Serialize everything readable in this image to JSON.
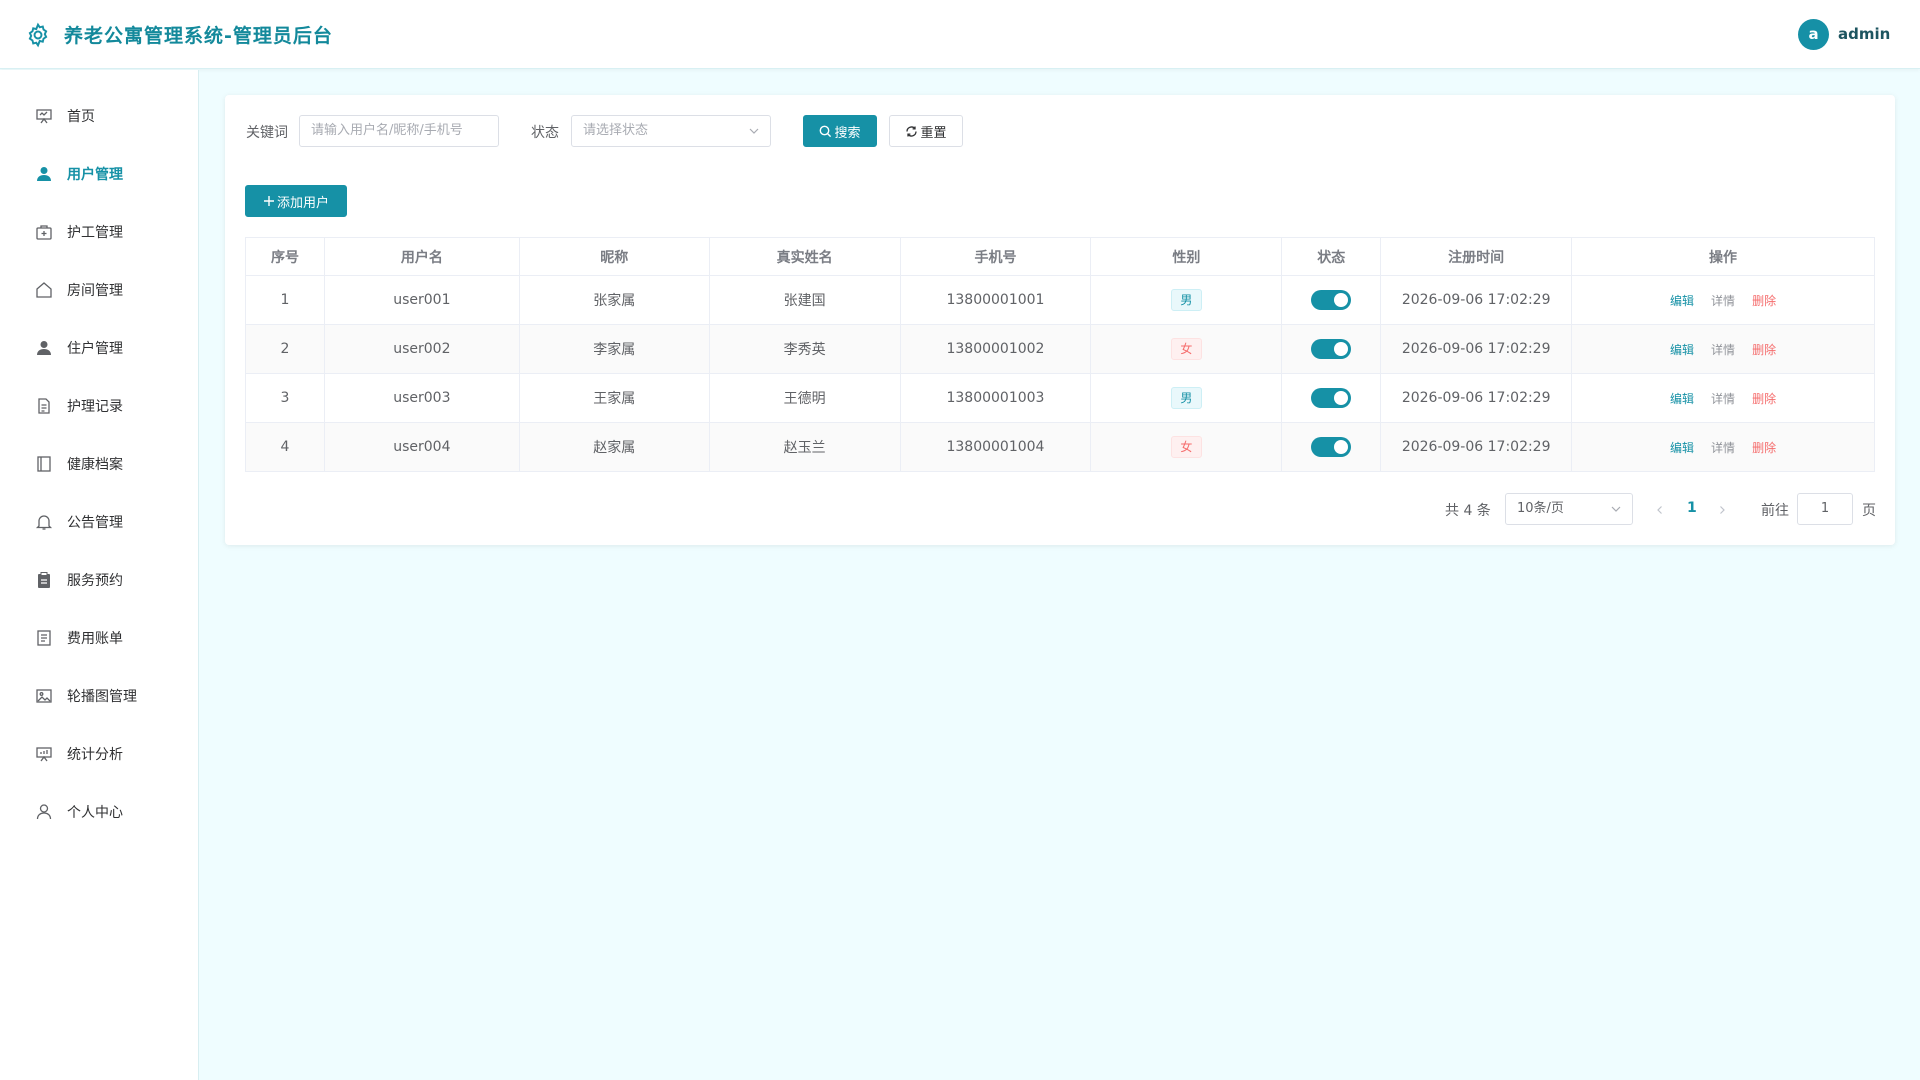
{
  "header": {
    "title": "养老公寓管理系统-管理员后台",
    "avatar_letter": "a",
    "user_name": "admin"
  },
  "sidebar": {
    "items": [
      {
        "label": "首页",
        "icon": "dashboard-icon"
      },
      {
        "label": "用户管理",
        "icon": "user-icon",
        "active": true
      },
      {
        "label": "护工管理",
        "icon": "first-aid-kit-icon"
      },
      {
        "label": "房间管理",
        "icon": "house-icon"
      },
      {
        "label": "住户管理",
        "icon": "resident-icon"
      },
      {
        "label": "护理记录",
        "icon": "document-icon"
      },
      {
        "label": "健康档案",
        "icon": "notebook-icon"
      },
      {
        "label": "公告管理",
        "icon": "bell-icon"
      },
      {
        "label": "服务预约",
        "icon": "clipboard-icon"
      },
      {
        "label": "费用账单",
        "icon": "bill-icon"
      },
      {
        "label": "轮播图管理",
        "icon": "picture-icon"
      },
      {
        "label": "统计分析",
        "icon": "chart-board-icon"
      },
      {
        "label": "个人中心",
        "icon": "profile-icon"
      }
    ]
  },
  "filters": {
    "keyword_label": "关键词",
    "keyword_placeholder": "请输入用户名/昵称/手机号",
    "status_label": "状态",
    "status_placeholder": "请选择状态",
    "search_label": "搜索",
    "reset_label": "重置"
  },
  "toolbar": {
    "add_label": "添加用户"
  },
  "table": {
    "columns": [
      "序号",
      "用户名",
      "昵称",
      "真实姓名",
      "手机号",
      "性别",
      "状态",
      "注册时间",
      "操作"
    ],
    "rows": [
      {
        "index": "1",
        "username": "user001",
        "nickname": "张家属",
        "realname": "张建国",
        "phone": "13800001001",
        "gender": "男",
        "enabled": true,
        "registered": "2026-09-06 17:02:29"
      },
      {
        "index": "2",
        "username": "user002",
        "nickname": "李家属",
        "realname": "李秀英",
        "phone": "13800001002",
        "gender": "女",
        "enabled": true,
        "registered": "2026-09-06 17:02:29"
      },
      {
        "index": "3",
        "username": "user003",
        "nickname": "王家属",
        "realname": "王德明",
        "phone": "13800001003",
        "gender": "男",
        "enabled": true,
        "registered": "2026-09-06 17:02:29"
      },
      {
        "index": "4",
        "username": "user004",
        "nickname": "赵家属",
        "realname": "赵玉兰",
        "phone": "13800001004",
        "gender": "女",
        "enabled": true,
        "registered": "2026-09-06 17:02:29"
      }
    ],
    "actions": {
      "edit": "编辑",
      "detail": "详情",
      "delete": "删除"
    }
  },
  "pagination": {
    "total": "共 4 条",
    "page_size": "10条/页",
    "current_page": "1",
    "goto_label": "前往",
    "jump_value": "1",
    "page_unit": "页"
  },
  "colors": {
    "primary": "#1691a6",
    "danger": "#f56c6c",
    "background": "#effdff"
  }
}
